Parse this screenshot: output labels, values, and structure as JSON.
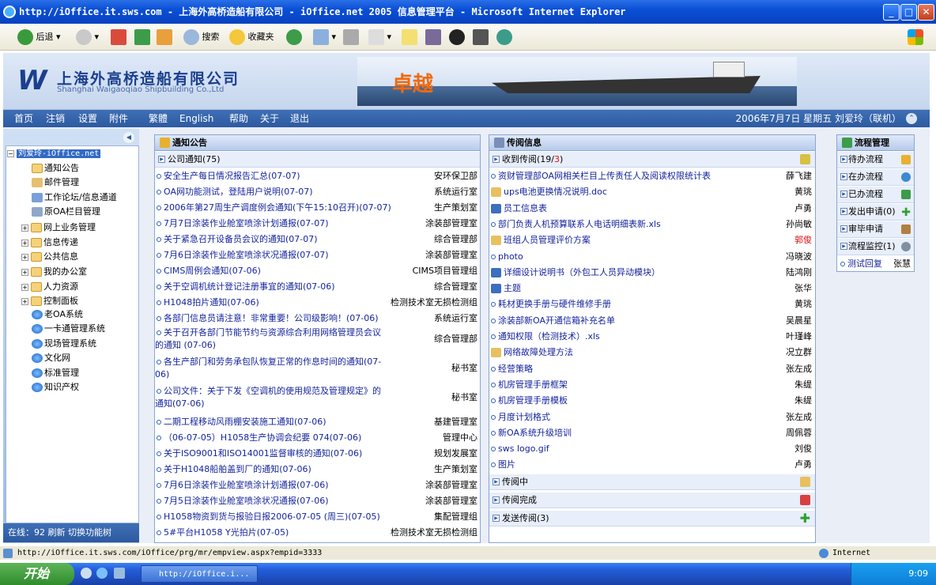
{
  "window": {
    "title": "http://iOffice.it.sws.com - 上海外高桥造船有限公司 - iOffice.net 2005 信息管理平台 - Microsoft Internet Explorer"
  },
  "toolbar": {
    "back": "后退",
    "search": "搜索",
    "favorites": "收藏夹"
  },
  "banner": {
    "company_cn": "上海外高桥造船有限公司",
    "company_en": "Shanghai Waigaoqiao Shipbuilding Co.,Ltd",
    "slogan": "卓越"
  },
  "nav": {
    "items": [
      "首页",
      "注销",
      "设置",
      "附件",
      "繁體",
      "English",
      "帮助",
      "关于",
      "退出"
    ],
    "date_user": "2006年7月7日 星期五  刘爱玲（联机）"
  },
  "tree": {
    "root": "刘爱玲-iOffice.net",
    "items": [
      "通知公告",
      "邮件管理",
      "工作论坛/信息通道",
      "原OA栏目管理",
      "网上业务管理",
      "信息传递",
      "公共信息",
      "我的办公室",
      "人力资源",
      "控制面板",
      "老OA系统",
      "一卡通管理系统",
      "现场管理系统",
      "文化网",
      "标准管理",
      "知识产权"
    ]
  },
  "left_status": "在线：92  刷新  切换功能树",
  "notice": {
    "title": "通知公告",
    "section": "公司通知(75)",
    "rows": [
      {
        "t": "安全生产每日情况报告汇总(07-07)",
        "d": "安环保卫部"
      },
      {
        "t": "OA网功能测试，登陆用户说明(07-07)",
        "d": "系统运行室"
      },
      {
        "t": "2006年第27周生产调度例会通知(下午15:10召开)(07-07)",
        "d": "生产策划室"
      },
      {
        "t": "7月7日涂装作业舱室喷涂计划通报(07-07)",
        "d": "涂装部管理室"
      },
      {
        "t": "关于紧急召开设备员会议的通知(07-07)",
        "d": "综合管理部"
      },
      {
        "t": "7月6日涂装作业舱室喷涂状况通报(07-07)",
        "d": "涂装部管理室"
      },
      {
        "t": "CIMS周例会通知(07-06)",
        "d": "CIMS项目管理组"
      },
      {
        "t": "关于空调机统计登记注册事宜的通知(07-06)",
        "d": "综合管理室"
      },
      {
        "t": "H1048拍片通知(07-06)",
        "d": "检测技术室无损检测组"
      },
      {
        "t": "各部门信息员请注意！非常重要！公司级影响！(07-06)",
        "d": "系统运行室"
      },
      {
        "t": "关于召开各部门节能节约与资源综合利用网络管理员会议",
        "t2": "的通知 (07-06)",
        "d": "综合管理部"
      },
      {
        "t": "各生产部门和劳务承包队恢复正常的作息时间的通知(07-",
        "t2": "06)",
        "d": "秘书室"
      },
      {
        "t": "公司文件：关于下发《空调机的使用规范及管理规定》的",
        "t2": "通知(07-06)",
        "d": "秘书室"
      },
      {
        "t": "二期工程移动风雨棚安装施工通知(07-06)",
        "d": "基建管理室"
      },
      {
        "t": "（06-07-05）H1058生产协调会纪要  074(07-06)",
        "d": "管理中心"
      },
      {
        "t": "关于ISO9001和ISO14001监督审核的通知(07-06)",
        "d": "规划发展室"
      },
      {
        "t": "关于H1048船舶盖到厂的通知(07-06)",
        "d": "生产策划室"
      },
      {
        "t": "7月6日涂装作业舱室喷涂计划通报(07-06)",
        "d": "涂装部管理室"
      },
      {
        "t": "7月5日涂装作业舱室喷涂状况通报(07-06)",
        "d": "涂装部管理室"
      },
      {
        "t": "H1058物资到货与报验日报2006-07-05 (周三)(07-05)",
        "d": "集配管理组"
      },
      {
        "t": "5#平台H1058 Y光拍片(07-05)",
        "d": "检测技术室无损检测组"
      }
    ]
  },
  "circulate": {
    "title": "传阅信息",
    "received": "收到传阅(19/",
    "received_unread": "3",
    "received_end": ")",
    "rows": [
      {
        "t": "资财管理部OA网相关栏目上传责任人及阅读权限统计表",
        "w": "薛飞建"
      },
      {
        "t": "ups电池更换情况说明.doc",
        "w": "黄珧"
      },
      {
        "t": "员工信息表",
        "w": "卢勇"
      },
      {
        "t": "部门负责人机预算联系人电话明细表新.xls",
        "w": "孙尚敏"
      },
      {
        "t": "班组人员管理评价方案",
        "w": "郭俊",
        "red": true
      },
      {
        "t": "photo",
        "w": "冯晓波"
      },
      {
        "t": "详细设计说明书（外包工人员异动模块）",
        "w": "陆鸿刚"
      },
      {
        "t": "主题",
        "w": "张华"
      },
      {
        "t": "耗材更换手册与硬件维修手册",
        "w": "黄珧"
      },
      {
        "t": "涂装部新OA开通信箱补充名单",
        "w": "吴晨星"
      },
      {
        "t": "通知权限（检测技术）.xls",
        "w": "叶瑾峰"
      },
      {
        "t": "网络故障处理方法",
        "w": "况立群"
      },
      {
        "t": "经营策略",
        "w": "张左成"
      },
      {
        "t": "机房管理手册框架",
        "w": "朱缇"
      },
      {
        "t": "机房管理手册模板",
        "w": "朱缇"
      },
      {
        "t": "月度计划格式",
        "w": "张左成"
      },
      {
        "t": "新OA系统升级培训",
        "w": "周佩蓉"
      },
      {
        "t": "sws logo.gif",
        "w": "刘俊"
      },
      {
        "t": "图片",
        "w": "卢勇"
      }
    ],
    "in_progress": "传阅中",
    "done": "传阅完成",
    "sent": "发送传阅(3)"
  },
  "workflow": {
    "title": "流程管理",
    "items": [
      "待办流程",
      "在办流程",
      "已办流程",
      "发出申请(0)",
      "审毕申请",
      "流程监控(1)"
    ],
    "last": "测试回复",
    "last_who": "张慧"
  },
  "statusbar": {
    "url": "http://iOffice.it.sws.com/iOffice/prg/mr/empview.aspx?empid=3333",
    "zone": "Internet"
  },
  "taskbar": {
    "start": "开始",
    "item": "http://iOffice.i...",
    "time": "9:09"
  },
  "colors": {
    "nav_blue": "#2d5aa0",
    "link_blue": "#14249c",
    "accent_orange": "#ef6a10",
    "unread_red": "#d81010"
  }
}
